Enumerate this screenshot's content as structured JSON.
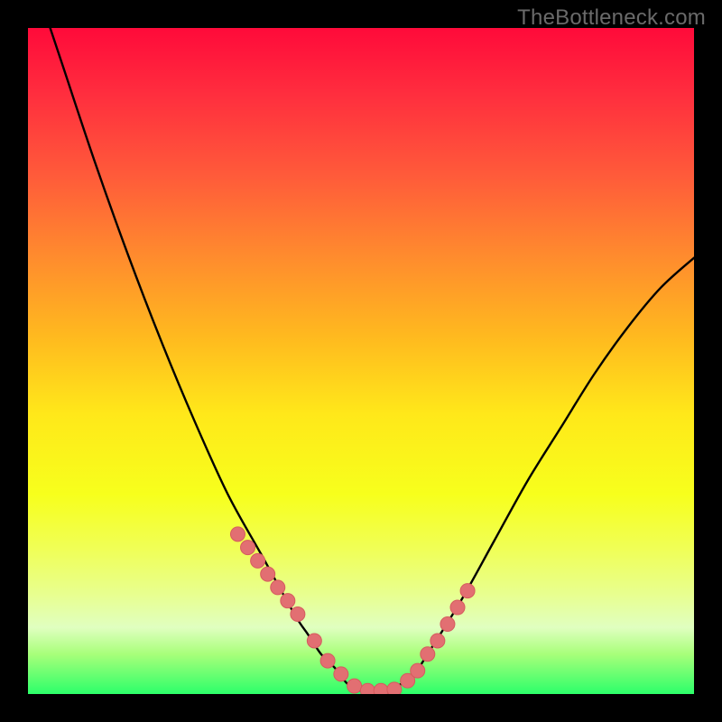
{
  "watermark": "TheBottleneck.com",
  "colors": {
    "frame": "#000000",
    "curve": "#000000",
    "marker_fill": "#e26f72",
    "marker_stroke": "#d65a5e",
    "gradient_top": "#ff0a3a",
    "gradient_bottom": "#2cff6a"
  },
  "chart_data": {
    "type": "line",
    "title": "",
    "xlabel": "",
    "ylabel": "",
    "xlim": [
      0,
      100
    ],
    "ylim": [
      0,
      100
    ],
    "grid": false,
    "legend": false,
    "series": [
      {
        "name": "bottleneck-curve",
        "x": [
          0,
          5,
          10,
          15,
          20,
          25,
          30,
          35,
          40,
          42,
          44,
          46,
          48,
          50,
          52,
          54,
          56,
          58,
          60,
          65,
          70,
          75,
          80,
          85,
          90,
          95,
          100
        ],
        "values": [
          110,
          95,
          80,
          66,
          53,
          41,
          30,
          21,
          12,
          9,
          6,
          4,
          1.5,
          0.5,
          0.5,
          0.6,
          1.5,
          3,
          6,
          14,
          23,
          32,
          40,
          48,
          55,
          61,
          65.5
        ]
      }
    ],
    "markers": {
      "name": "highlighted-points",
      "x": [
        31.5,
        33,
        34.5,
        36,
        37.5,
        39,
        40.5,
        43,
        45,
        47,
        49,
        51,
        53,
        55,
        57,
        58.5,
        60,
        61.5,
        63,
        64.5,
        66
      ],
      "values": [
        24,
        22,
        20,
        18,
        16,
        14,
        12,
        8,
        5,
        3,
        1.2,
        0.5,
        0.5,
        0.7,
        2,
        3.5,
        6,
        8,
        10.5,
        13,
        15.5
      ]
    }
  }
}
